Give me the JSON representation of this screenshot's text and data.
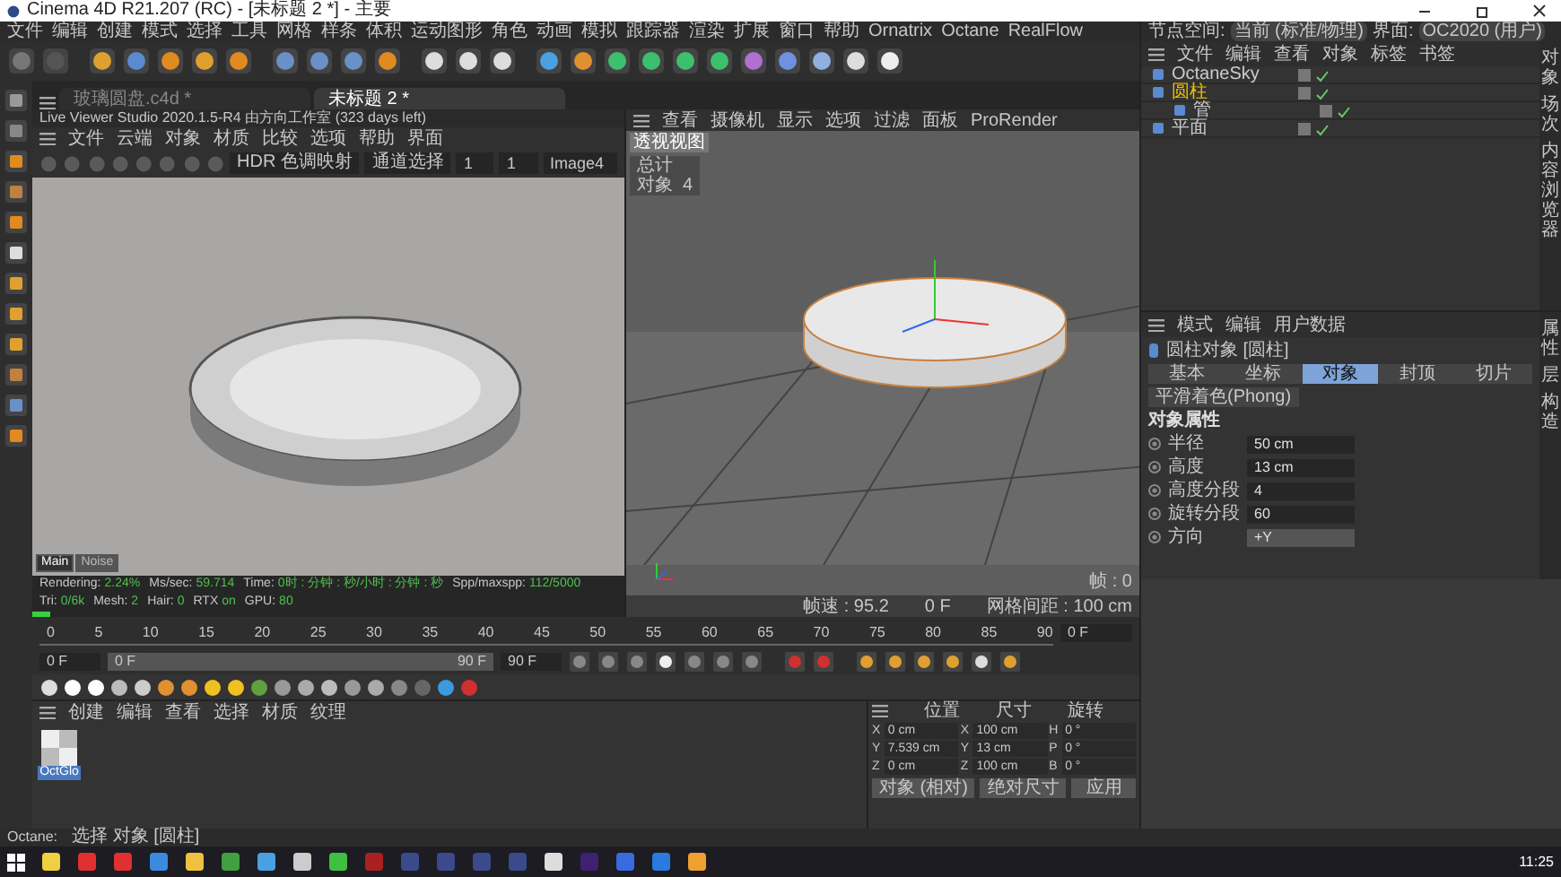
{
  "window": {
    "title": "Cinema 4D R21.207 (RC) - [未标题 2 *] - 主要"
  },
  "menu_bar": [
    "文件",
    "编辑",
    "创建",
    "模式",
    "选择",
    "工具",
    "网格",
    "样条",
    "体积",
    "运动图形",
    "角色",
    "动画",
    "模拟",
    "跟踪器",
    "渲染",
    "扩展",
    "窗口",
    "帮助",
    "Ornatrix",
    "Octane",
    "RealFlow"
  ],
  "node_space": {
    "label": "节点空间:",
    "value": "当前 (标准/物理)"
  },
  "layout_selector": {
    "label": "界面:",
    "value": "OC2020 (用户)"
  },
  "doc_tabs": [
    {
      "label": "玻璃圆盘.c4d *",
      "selected": false
    },
    {
      "label": "未标题 2 *",
      "selected": true
    }
  ],
  "live_viewer": {
    "title": "Live Viewer Studio 2020.1.5-R4 由方向工作室 (323 days left)",
    "menu": [
      "文件",
      "云端",
      "对象",
      "材质",
      "比较",
      "选项",
      "帮助",
      "界面"
    ],
    "dropdowns": [
      "HDR 色调映射",
      "通道选择"
    ],
    "fields": [
      "1",
      "1"
    ],
    "image": "Image4",
    "tabs": [
      {
        "label": "Main",
        "selected": true
      },
      {
        "label": "Noise",
        "selected": false
      }
    ],
    "status": [
      {
        "label": "Rendering:",
        "value": "2.24%"
      },
      {
        "label": "Ms/sec:",
        "value": "59.714"
      },
      {
        "label": "Time:",
        "value": "0时 : 分钟 : 秒/小时 : 分钟 : 秒"
      },
      {
        "label": "Spp/maxspp:",
        "value": "112/5000"
      },
      {
        "label": "Tri:",
        "value": "0/6k"
      },
      {
        "label": "Mesh:",
        "value": "2"
      },
      {
        "label": "Hair:",
        "value": "0"
      },
      {
        "label": "RTX",
        "value": "on"
      },
      {
        "label": "GPU:",
        "value": "80"
      }
    ],
    "progress": {
      "level": 0.03
    }
  },
  "viewport": {
    "menu": [
      "查看",
      "摄像机",
      "显示",
      "选项",
      "过滤",
      "面板",
      "ProRender"
    ],
    "title": "透视视图",
    "hud": [
      "总计",
      "对象  4"
    ],
    "frame_rate": "帧速 : 95.2",
    "current_frame": "0 F",
    "grid_spacing": "网格间距 : 100 cm",
    "frame_count": "帧 : 0"
  },
  "object_manager": {
    "menu": [
      "文件",
      "编辑",
      "查看",
      "对象",
      "标签",
      "书签"
    ],
    "objects": [
      {
        "name": "OctaneSky",
        "selected": false
      },
      {
        "name": "圆柱",
        "selected": true,
        "children": [
          {
            "name": "管",
            "selected": false
          }
        ]
      },
      {
        "name": "平面",
        "selected": false
      }
    ]
  },
  "side_tabs_top": [
    "对象",
    "场次",
    "内容浏览器"
  ],
  "side_tabs_bottom": [
    "属性",
    "层",
    "构造"
  ],
  "attributes": {
    "menu": [
      "模式",
      "编辑",
      "用户数据"
    ],
    "object_title": "圆柱对象 [圆柱]",
    "tabs": [
      {
        "label": "基本",
        "selected": false
      },
      {
        "label": "坐标",
        "selected": false
      },
      {
        "label": "对象",
        "selected": true
      },
      {
        "label": "封顶",
        "selected": false
      },
      {
        "label": "切片",
        "selected": false
      }
    ],
    "phong_button": "平滑着色(Phong)",
    "section": "对象属性",
    "fields": [
      {
        "label": "半径",
        "value": "50 cm",
        "kind": "number"
      },
      {
        "label": "高度",
        "value": "13 cm",
        "kind": "number"
      },
      {
        "label": "高度分段",
        "value": "4",
        "kind": "number"
      },
      {
        "label": "旋转分段",
        "value": "60",
        "kind": "number"
      },
      {
        "label": "方向",
        "value": "+Y",
        "kind": "dropdown"
      }
    ]
  },
  "timeline": {
    "ticks": [
      "0",
      "5",
      "10",
      "15",
      "20",
      "25",
      "30",
      "35",
      "40",
      "45",
      "50",
      "55",
      "60",
      "65",
      "70",
      "75",
      "80",
      "85",
      "90"
    ],
    "current_field": "0 F",
    "start_field": "0 F",
    "range": {
      "start": "0 F",
      "end": "90 F",
      "level": 1
    },
    "end_field": "90 F"
  },
  "materials": {
    "menu": [
      "创建",
      "编辑",
      "查看",
      "选择",
      "材质",
      "纹理"
    ],
    "items": [
      {
        "name": "OctGlo",
        "selected": true
      }
    ]
  },
  "coordinates": {
    "headers": [
      "位置",
      "尺寸",
      "旋转"
    ],
    "rows": [
      [
        "X",
        "0 cm",
        "X",
        "100 cm",
        "H",
        "0 °"
      ],
      [
        "Y",
        "7.539 cm",
        "Y",
        "13 cm",
        "P",
        "0 °"
      ],
      [
        "Z",
        "0 cm",
        "Z",
        "100 cm",
        "B",
        "0 °"
      ]
    ],
    "mode": "对象 (相对)",
    "size_mode": "绝对尺寸",
    "apply": "应用"
  },
  "status_bar": {
    "label": "Octane:",
    "text": "选择 对象 [圆柱]"
  },
  "taskbar": {
    "time": "11:25"
  }
}
